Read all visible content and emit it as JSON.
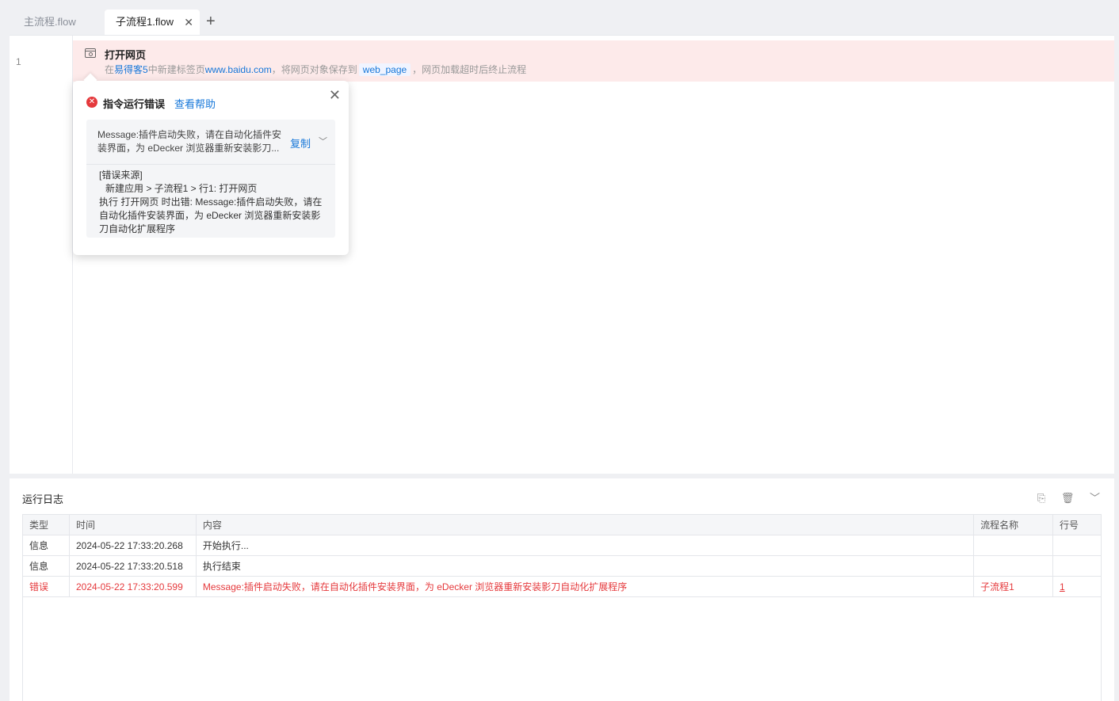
{
  "tabs": {
    "main": "主流程.flow",
    "sub": "子流程1.flow",
    "close": "✕",
    "add": "+"
  },
  "editor": {
    "line_number": "1",
    "command": {
      "title": "打开网页",
      "desc_prefix": "在",
      "browser": "易得客5",
      "desc_mid": "中新建标签页",
      "url": "www.baidu.com",
      "desc_save": "，将网页对象保存到",
      "var": "web_page",
      "desc_suffix": "，网页加载超时后终止流程"
    }
  },
  "popup": {
    "title": "指令运行错误",
    "help": "查看帮助",
    "close": "✕",
    "message": "Message:插件启动失败，请在自动化插件安装界面，为 eDecker 浏览器重新安装影刀...",
    "copy": "复制",
    "detail_source": "[错误来源]",
    "detail_path": "新建应用 > 子流程1 > 行1: 打开网页",
    "detail_text": "执行 打开网页 时出错: Message:插件启动失败，请在自动化插件安装界面，为 eDecker 浏览器重新安装影刀自动化扩展程序"
  },
  "log": {
    "title": "运行日志",
    "columns": {
      "type": "类型",
      "time": "时间",
      "content": "内容",
      "flow": "流程名称",
      "line": "行号"
    },
    "rows": [
      {
        "type": "信息",
        "time": "2024-05-22 17:33:20.268",
        "content": "开始执行...",
        "flow": "",
        "line": ""
      },
      {
        "type": "信息",
        "time": "2024-05-22 17:33:20.518",
        "content": "执行结束",
        "flow": "",
        "line": ""
      },
      {
        "type": "错误",
        "time": "2024-05-22 17:33:20.599",
        "content": "Message:插件启动失败，请在自动化插件安装界面，为 eDecker 浏览器重新安装影刀自动化扩展程序",
        "flow": "子流程1",
        "line": "1"
      }
    ]
  },
  "colors": {
    "error": "#e5393c",
    "link": "#1677d9",
    "error_row_bg": "#fdeaea"
  }
}
